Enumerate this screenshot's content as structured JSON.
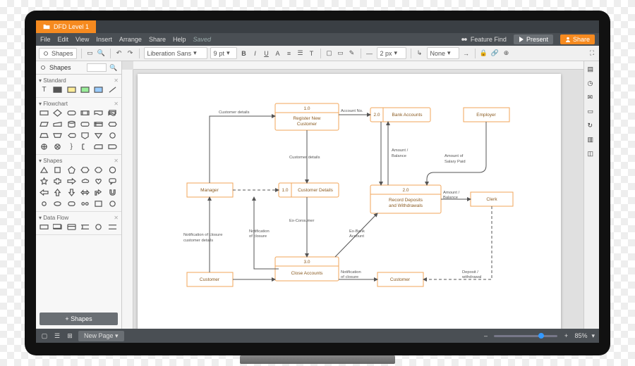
{
  "title": "DFD Level 1",
  "menus": {
    "file": "File",
    "edit": "Edit",
    "view": "View",
    "insert": "Insert",
    "arrange": "Arrange",
    "share": "Share",
    "help": "Help",
    "saved": "Saved"
  },
  "topright": {
    "feature_find": "Feature Find",
    "present": "Present",
    "share": "Share"
  },
  "toolbar": {
    "shapes": "Shapes",
    "font": "Liberation Sans",
    "size_unit": "pt",
    "size_value": "9",
    "bold": "B",
    "italic": "I",
    "underline": "U",
    "strike": "A",
    "border_width": "2 px",
    "line_style": "None"
  },
  "panel": {
    "search_placeholder": "",
    "groups": {
      "standard": "Standard",
      "flowchart": "Flowchart",
      "shapes": "Shapes",
      "dataflow": "Data Flow"
    },
    "add_shapes": "+  Shapes"
  },
  "diagram": {
    "processes": [
      {
        "id": "1.0",
        "label": "Register New Customer"
      },
      {
        "id": "1.0",
        "label": "Customer Details"
      },
      {
        "id": "2.0",
        "label": "Bank Accounts"
      },
      {
        "id": "2.0",
        "label": "Record Deposits and Withdrawals"
      },
      {
        "id": "3.0",
        "label": "Close Accounts"
      }
    ],
    "entities": [
      "Manager",
      "Customer",
      "Customer",
      "Employer",
      "Clerk"
    ],
    "flows": [
      "Customer details",
      "Customer details",
      "Account No.",
      "Amount / Balance",
      "Amount of Salary Paid",
      "Amount / Balance",
      "Ex-Consumer",
      "Ex-Bank Account",
      "Notification of closure customer details",
      "Notification of closure",
      "Notification of closure",
      "Deposit / withdrawal"
    ]
  },
  "statusbar": {
    "new_page": "New Page",
    "zoom_pct": "85%"
  }
}
